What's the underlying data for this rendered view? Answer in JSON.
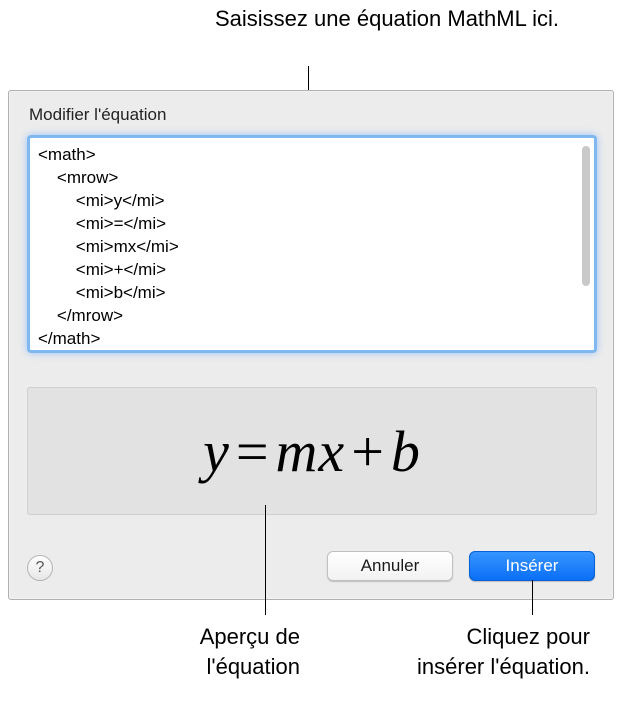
{
  "callouts": {
    "top": "Saisissez une équation MathML ici.",
    "bottom_left_l1": "Aperçu de",
    "bottom_left_l2": "l'équation",
    "bottom_right_l1": "Cliquez pour",
    "bottom_right_l2": "insérer l'équation."
  },
  "dialog": {
    "title": "Modifier l'équation",
    "help_symbol": "?",
    "buttons": {
      "cancel": "Annuler",
      "insert": "Insérer"
    }
  },
  "editor": {
    "content": "<math>\n    <mrow>\n        <mi>y</mi>\n        <mi>=</mi>\n        <mi>mx</mi>\n        <mi>+</mi>\n        <mi>b</mi>\n    </mrow>\n</math>"
  },
  "preview_equation": {
    "y": "y",
    "eq": "=",
    "mx": "mx",
    "plus": "+",
    "b": "b"
  }
}
